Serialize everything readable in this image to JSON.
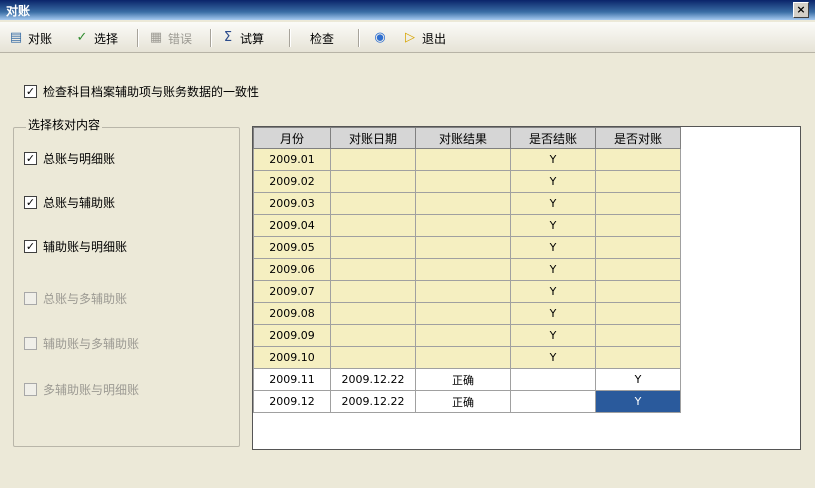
{
  "window": {
    "title": "对账",
    "close_glyph": "×"
  },
  "toolbar": [
    {
      "icon": "reconcile-icon",
      "label": "对账",
      "disabled": false
    },
    {
      "icon": "select-check-icon",
      "label": "选择",
      "disabled": false
    },
    {
      "icon": "error-doc-icon",
      "label": "错误",
      "disabled": true
    },
    {
      "icon": "trial-calc-icon",
      "label": "试算",
      "disabled": false
    },
    {
      "icon": "",
      "label": "检查",
      "disabled": false
    },
    {
      "icon": "help-icon",
      "label": "",
      "disabled": false
    },
    {
      "icon": "exit-icon",
      "label": "退出",
      "disabled": false
    }
  ],
  "top_check": {
    "label": "检查科目档案辅助项与账务数据的一致性",
    "checked": true
  },
  "group": {
    "title": "选择核对内容",
    "items": [
      {
        "label": "总账与明细账",
        "checked": true,
        "enabled": true
      },
      {
        "label": "总账与辅助账",
        "checked": true,
        "enabled": true
      },
      {
        "label": "辅助账与明细账",
        "checked": true,
        "enabled": true
      },
      {
        "label": "总账与多辅助账",
        "checked": false,
        "enabled": false
      },
      {
        "label": "辅助账与多辅助账",
        "checked": false,
        "enabled": false
      },
      {
        "label": "多辅助账与明细账",
        "checked": false,
        "enabled": false
      }
    ]
  },
  "grid": {
    "columns": [
      "月份",
      "对账日期",
      "对账结果",
      "是否结账",
      "是否对账"
    ],
    "rows": [
      {
        "month": "2009.01",
        "date": "",
        "result": "",
        "closed": "Y",
        "reconciled": ""
      },
      {
        "month": "2009.02",
        "date": "",
        "result": "",
        "closed": "Y",
        "reconciled": ""
      },
      {
        "month": "2009.03",
        "date": "",
        "result": "",
        "closed": "Y",
        "reconciled": ""
      },
      {
        "month": "2009.04",
        "date": "",
        "result": "",
        "closed": "Y",
        "reconciled": ""
      },
      {
        "month": "2009.05",
        "date": "",
        "result": "",
        "closed": "Y",
        "reconciled": ""
      },
      {
        "month": "2009.06",
        "date": "",
        "result": "",
        "closed": "Y",
        "reconciled": ""
      },
      {
        "month": "2009.07",
        "date": "",
        "result": "",
        "closed": "Y",
        "reconciled": ""
      },
      {
        "month": "2009.08",
        "date": "",
        "result": "",
        "closed": "Y",
        "reconciled": ""
      },
      {
        "month": "2009.09",
        "date": "",
        "result": "",
        "closed": "Y",
        "reconciled": ""
      },
      {
        "month": "2009.10",
        "date": "",
        "result": "",
        "closed": "Y",
        "reconciled": ""
      },
      {
        "month": "2009.11",
        "date": "2009.12.22",
        "result": "正确",
        "closed": "",
        "reconciled": "Y"
      },
      {
        "month": "2009.12",
        "date": "2009.12.22",
        "result": "正确",
        "closed": "",
        "reconciled": "Y"
      }
    ],
    "selected_cell": {
      "row": 11,
      "col": "reconciled"
    },
    "colors": {
      "closed_row_bg": "#f5efc1",
      "selection_bg": "#2a5a9c"
    }
  }
}
